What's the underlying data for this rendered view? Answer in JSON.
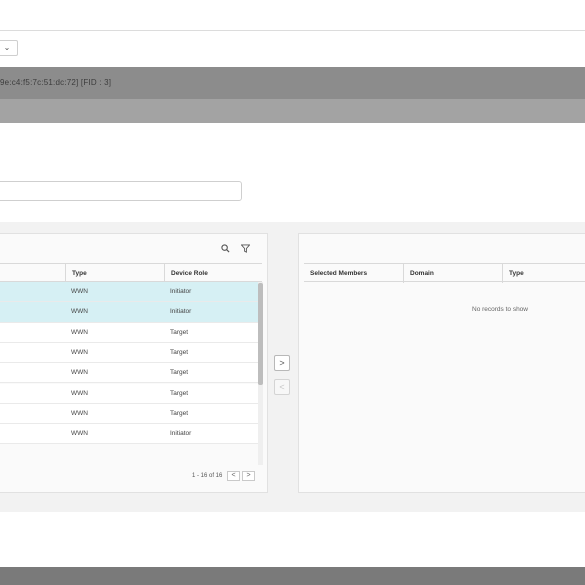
{
  "header": {
    "dropdown_chevron": "⌄",
    "title": "9e:c4:f5:7c:51:dc:72] [FID : 3]"
  },
  "name_field": {
    "value": ""
  },
  "available": {
    "columns": [
      "Type",
      "Device Role"
    ],
    "rows": [
      {
        "type": "WWN",
        "role": "Initiator",
        "selected": true
      },
      {
        "type": "WWN",
        "role": "Initiator",
        "selected": true
      },
      {
        "type": "WWN",
        "role": "Target",
        "selected": false
      },
      {
        "type": "WWN",
        "role": "Target",
        "selected": false
      },
      {
        "type": "WWN",
        "role": "Target",
        "selected": false
      },
      {
        "type": "WWN",
        "role": "Target",
        "selected": false
      },
      {
        "type": "WWN",
        "role": "Target",
        "selected": false
      },
      {
        "type": "WWN",
        "role": "Initiator",
        "selected": false
      }
    ],
    "pager_text": "1 - 16 of 16",
    "prev": "<",
    "next": ">"
  },
  "transfer": {
    "add": ">",
    "remove": "<"
  },
  "selected": {
    "columns": [
      "Selected Members",
      "Domain",
      "Type"
    ],
    "empty_text": "No records to show"
  },
  "icons": {
    "search": "search-icon",
    "filter": "filter-icon"
  }
}
